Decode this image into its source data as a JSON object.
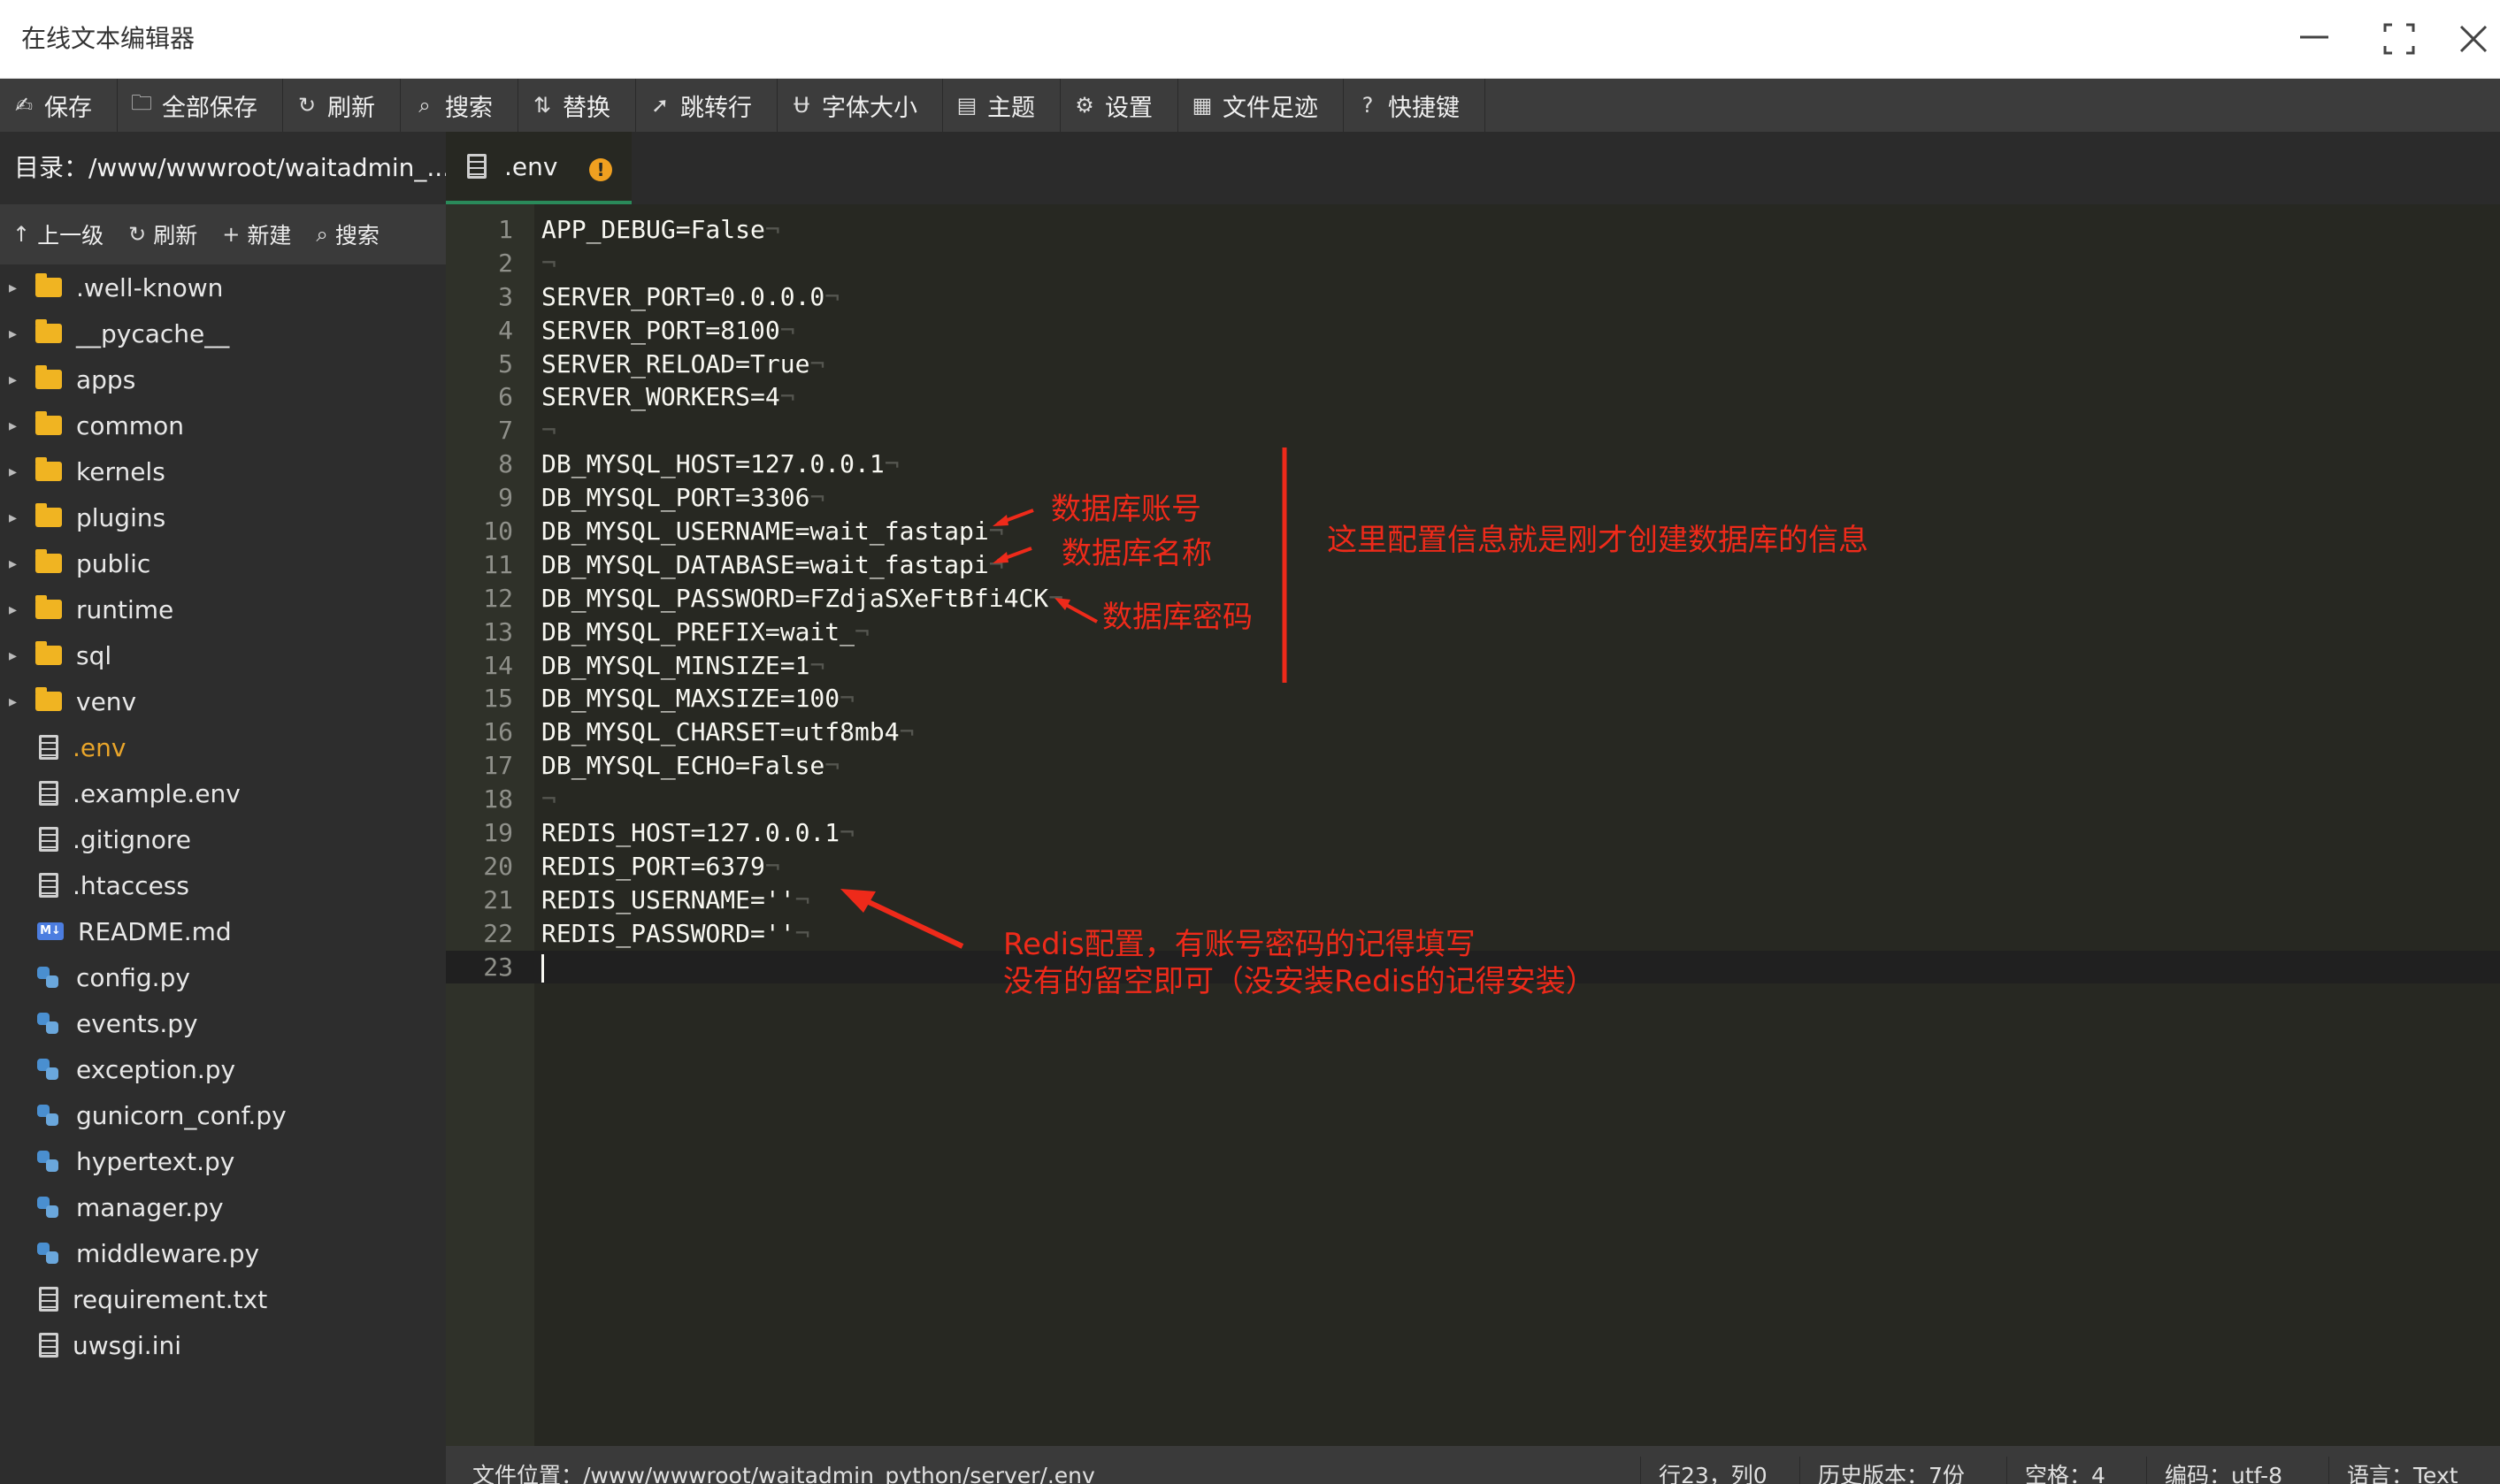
{
  "window": {
    "title": "在线文本编辑器"
  },
  "toolbar": {
    "items": [
      {
        "icon": "✍",
        "label": "保存"
      },
      {
        "icon": "🗀",
        "label": "全部保存"
      },
      {
        "icon": "↻",
        "label": "刷新"
      },
      {
        "icon": "⌕",
        "label": "搜索"
      },
      {
        "icon": "⇅",
        "label": "替换"
      },
      {
        "icon": "➚",
        "label": "跳转行"
      },
      {
        "icon": "Ʉ",
        "label": "字体大小"
      },
      {
        "icon": "▤",
        "label": "主题"
      },
      {
        "icon": "⚙",
        "label": "设置"
      },
      {
        "icon": "▦",
        "label": "文件足迹"
      },
      {
        "icon": "?",
        "label": "快捷键"
      }
    ]
  },
  "explorer": {
    "directory": "目录：/www/wwwroot/waitadmin_...",
    "tools": [
      {
        "icon": "↑",
        "label": "上一级"
      },
      {
        "icon": "↻",
        "label": "刷新"
      },
      {
        "icon": "+",
        "label": "新建"
      },
      {
        "icon": "⌕",
        "label": "搜索"
      }
    ],
    "files": [
      {
        "name": ".well-known",
        "type": "folder"
      },
      {
        "name": "__pycache__",
        "type": "folder"
      },
      {
        "name": "apps",
        "type": "folder"
      },
      {
        "name": "common",
        "type": "folder"
      },
      {
        "name": "kernels",
        "type": "folder"
      },
      {
        "name": "plugins",
        "type": "folder"
      },
      {
        "name": "public",
        "type": "folder"
      },
      {
        "name": "runtime",
        "type": "folder"
      },
      {
        "name": "sql",
        "type": "folder"
      },
      {
        "name": "venv",
        "type": "folder"
      },
      {
        "name": ".env",
        "type": "doc",
        "active": true
      },
      {
        "name": ".example.env",
        "type": "doc"
      },
      {
        "name": ".gitignore",
        "type": "doc"
      },
      {
        "name": ".htaccess",
        "type": "doc"
      },
      {
        "name": "README.md",
        "type": "md"
      },
      {
        "name": "config.py",
        "type": "py"
      },
      {
        "name": "events.py",
        "type": "py"
      },
      {
        "name": "exception.py",
        "type": "py"
      },
      {
        "name": "gunicorn_conf.py",
        "type": "py"
      },
      {
        "name": "hypertext.py",
        "type": "py"
      },
      {
        "name": "manager.py",
        "type": "py"
      },
      {
        "name": "middleware.py",
        "type": "py"
      },
      {
        "name": "requirement.txt",
        "type": "doc"
      },
      {
        "name": "uwsgi.ini",
        "type": "doc"
      }
    ]
  },
  "editor": {
    "tab_label": ".env",
    "tab_warning": "!",
    "lines": [
      "APP_DEBUG=False",
      "",
      "SERVER_PORT=0.0.0.0",
      "SERVER_PORT=8100",
      "SERVER_RELOAD=True",
      "SERVER_WORKERS=4",
      "",
      "DB_MYSQL_HOST=127.0.0.1",
      "DB_MYSQL_PORT=3306",
      "DB_MYSQL_USERNAME=wait_fastapi",
      "DB_MYSQL_DATABASE=wait_fastapi",
      "DB_MYSQL_PASSWORD=FZdjaSXeFtBfi4CK",
      "DB_MYSQL_PREFIX=wait_",
      "DB_MYSQL_MINSIZE=1",
      "DB_MYSQL_MAXSIZE=100",
      "DB_MYSQL_CHARSET=utf8mb4",
      "DB_MYSQL_ECHO=False",
      "",
      "REDIS_HOST=127.0.0.1",
      "REDIS_PORT=6379",
      "REDIS_USERNAME=''",
      "REDIS_PASSWORD=''",
      ""
    ],
    "current_line": 23,
    "eol_marker": "¬"
  },
  "annotations": {
    "db_username": "数据库账号",
    "db_name": "数据库名称",
    "db_password": "数据库密码",
    "db_summary": "这里配置信息就是刚才创建数据库的信息",
    "redis_line1": "Redis配置，有账号密码的记得填写",
    "redis_line2": "没有的留空即可（没安装Redis的记得安装）",
    "color": "#ee2a1a"
  },
  "status": {
    "file_path": "文件位置：/www/wwwroot/waitadmin_python/server/.env",
    "cursor": "行23，列0",
    "history": "历史版本：7份",
    "indent": "空格：4",
    "encoding": "编码：utf-8",
    "language": "语言：Text"
  },
  "colors": {
    "background": "#272822",
    "toolbar": "#3c3c3c",
    "folder": "#f0b422",
    "active_file": "#e9a52a",
    "warning": "#f0a020"
  }
}
